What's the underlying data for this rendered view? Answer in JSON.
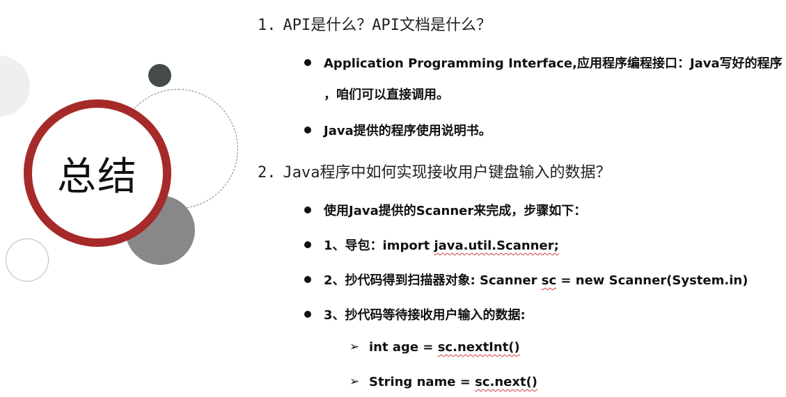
{
  "badge": {
    "title": "总结"
  },
  "sections": [
    {
      "number": "1.",
      "heading": "API是什么？API文档是什么？",
      "bullets": [
        {
          "text_line1": "Application Programming Interface,应用程序编程接口：Java写好的程序",
          "text_line2": "，咱们可以直接调用。"
        },
        {
          "text": "Java提供的程序使用说明书。"
        }
      ]
    },
    {
      "number": "2.",
      "heading": "Java程序中如何实现接收用户键盘输入的数据？",
      "bullets": [
        {
          "text": "使用Java提供的Scanner来完成，步骤如下："
        },
        {
          "prefix": "1、导包：import ",
          "code": "java.util.Scanner;"
        },
        {
          "prefix": "2、抄代码得到扫描器对象: Scanner ",
          "code": "sc",
          "suffix": " = new Scanner(System.in)"
        },
        {
          "text": "3、抄代码等待接收用户输入的数据:"
        }
      ],
      "sub_bullets": [
        {
          "prefix": "int age =  ",
          "code": "sc.nextInt()"
        },
        {
          "prefix": "String name = ",
          "code": "sc.next()"
        }
      ]
    }
  ],
  "colors": {
    "badge_ring": "#a62a2a",
    "dark_circle": "#454a4a",
    "gray_circle": "#888888",
    "light_circle": "#efefef",
    "spell_underline": "#d23a3a"
  },
  "icons": {
    "bullet": "filled-circle-bullet",
    "sub_bullet": "arrowhead-bullet"
  }
}
